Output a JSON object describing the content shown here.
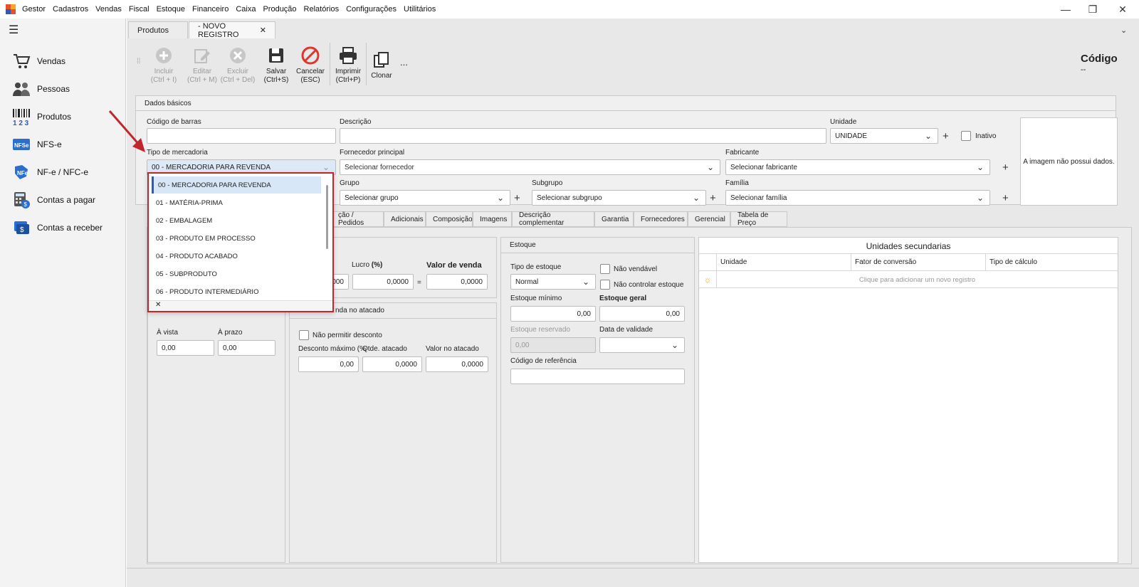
{
  "menu": {
    "app": "Gestor",
    "items": [
      "Cadastros",
      "Vendas",
      "Fiscal",
      "Estoque",
      "Financeiro",
      "Caixa",
      "Produção",
      "Relatórios",
      "Configurações",
      "Utilitários"
    ]
  },
  "window": {
    "minimize": "—",
    "restore": "❐",
    "close": "✕"
  },
  "sidebar": {
    "items": [
      {
        "label": "Vendas",
        "icon": "cart-icon"
      },
      {
        "label": "Pessoas",
        "icon": "people-icon"
      },
      {
        "label": "Produtos",
        "icon": "barcode-icon"
      },
      {
        "label": "NFS-e",
        "icon": "nfse-icon"
      },
      {
        "label": "NF-e / NFC-e",
        "icon": "nfe-icon"
      },
      {
        "label": "Contas a pagar",
        "icon": "calculator-icon"
      },
      {
        "label": "Contas a receber",
        "icon": "receivable-icon"
      }
    ]
  },
  "tabs": {
    "produtos": "Produtos",
    "novo": "- NOVO REGISTRO",
    "close": "✕"
  },
  "toolbar": {
    "incluir": "Incluir",
    "incluir_k": "(Ctrl + I)",
    "editar": "Editar",
    "editar_k": "(Ctrl + M)",
    "excluir": "Excluir",
    "excluir_k": "(Ctrl + Del)",
    "salvar": "Salvar",
    "salvar_k": "(Ctrl+S)",
    "cancelar": "Cancelar",
    "cancelar_k": "(ESC)",
    "imprimir": "Imprimir",
    "imprimir_k": "(Ctrl+P)",
    "clonar": "Clonar",
    "more": "...",
    "codigo_label": "Código",
    "codigo_value": "--"
  },
  "dados": {
    "title": "Dados básicos",
    "codigo_barras": "Código de barras",
    "descricao": "Descrição",
    "unidade": "Unidade",
    "unidade_value": "UNIDADE",
    "inativo": "Inativo",
    "tipo_mercadoria": "Tipo de mercadoria",
    "tipo_value": "00 - MERCADORIA PARA REVENDA",
    "fornecedor": "Fornecedor principal",
    "fornecedor_ph": "Selecionar fornecedor",
    "fabricante": "Fabricante",
    "fabricante_ph": "Selecionar fabricante",
    "grupo": "Grupo",
    "grupo_ph": "Selecionar grupo",
    "subgrupo": "Subgrupo",
    "subgrupo_ph": "Selecionar subgrupo",
    "familia": "Família",
    "familia_ph": "Selecionar família",
    "imagem": "A imagem não possui dados."
  },
  "dropdown": {
    "items": [
      "00 - MERCADORIA PARA REVENDA",
      "01 - MATÉRIA-PRIMA",
      "02 - EMBALAGEM",
      "03 - PRODUTO EM PROCESSO",
      "04 - PRODUTO ACABADO",
      "05 - SUBPRODUTO",
      "06 - PRODUTO INTERMEDIÁRIO"
    ],
    "clear": "✕"
  },
  "subtabs": [
    "ção / Pedidos",
    "Adicionais",
    "Composição",
    "Imagens",
    "Descrição complementar",
    "Garantia",
    "Fornecedores",
    "Gerencial",
    "Tabela de Preço"
  ],
  "preco": {
    "partial": "000",
    "lucro": "Lucro",
    "lucro_pct": "(%)",
    "lucro_value": "0,0000",
    "eq": "=",
    "valor_venda": "Valor de venda",
    "valor_venda_value": "0,0000",
    "a_vista": "À vista",
    "a_vista_value": "0,00",
    "a_prazo": "À prazo",
    "a_prazo_value": "0,00"
  },
  "atacado": {
    "title": "nda no atacado",
    "nao_permitir": "Não permitir desconto",
    "desconto_max": "Desconto máximo (%",
    "desconto_value": "0,00",
    "qtde": "Qtde. atacado",
    "qtde_value": "0,0000",
    "valor": "Valor no atacado",
    "valor_value": "0,0000"
  },
  "estoque": {
    "title": "Estoque",
    "tipo": "Tipo de estoque",
    "tipo_value": "Normal",
    "nao_vendavel": "Não vendável",
    "nao_controlar": "Não controlar estoque",
    "minimo": "Estoque mínimo",
    "minimo_value": "0,00",
    "geral": "Estoque geral",
    "geral_value": "0,00",
    "reservado": "Estoque reservado",
    "reservado_value": "0,00",
    "validade": "Data de validade",
    "referencia": "Código de referência"
  },
  "unidades": {
    "title": "Unidades secundarias",
    "cols": [
      "Unidade",
      "Fator de conversão",
      "Tipo de cálculo"
    ],
    "add": "Clique para adicionar um novo registro"
  },
  "colors": {
    "accent": "#2a5cb8",
    "highlight": "#c0272d",
    "cancel": "#e0342c"
  }
}
